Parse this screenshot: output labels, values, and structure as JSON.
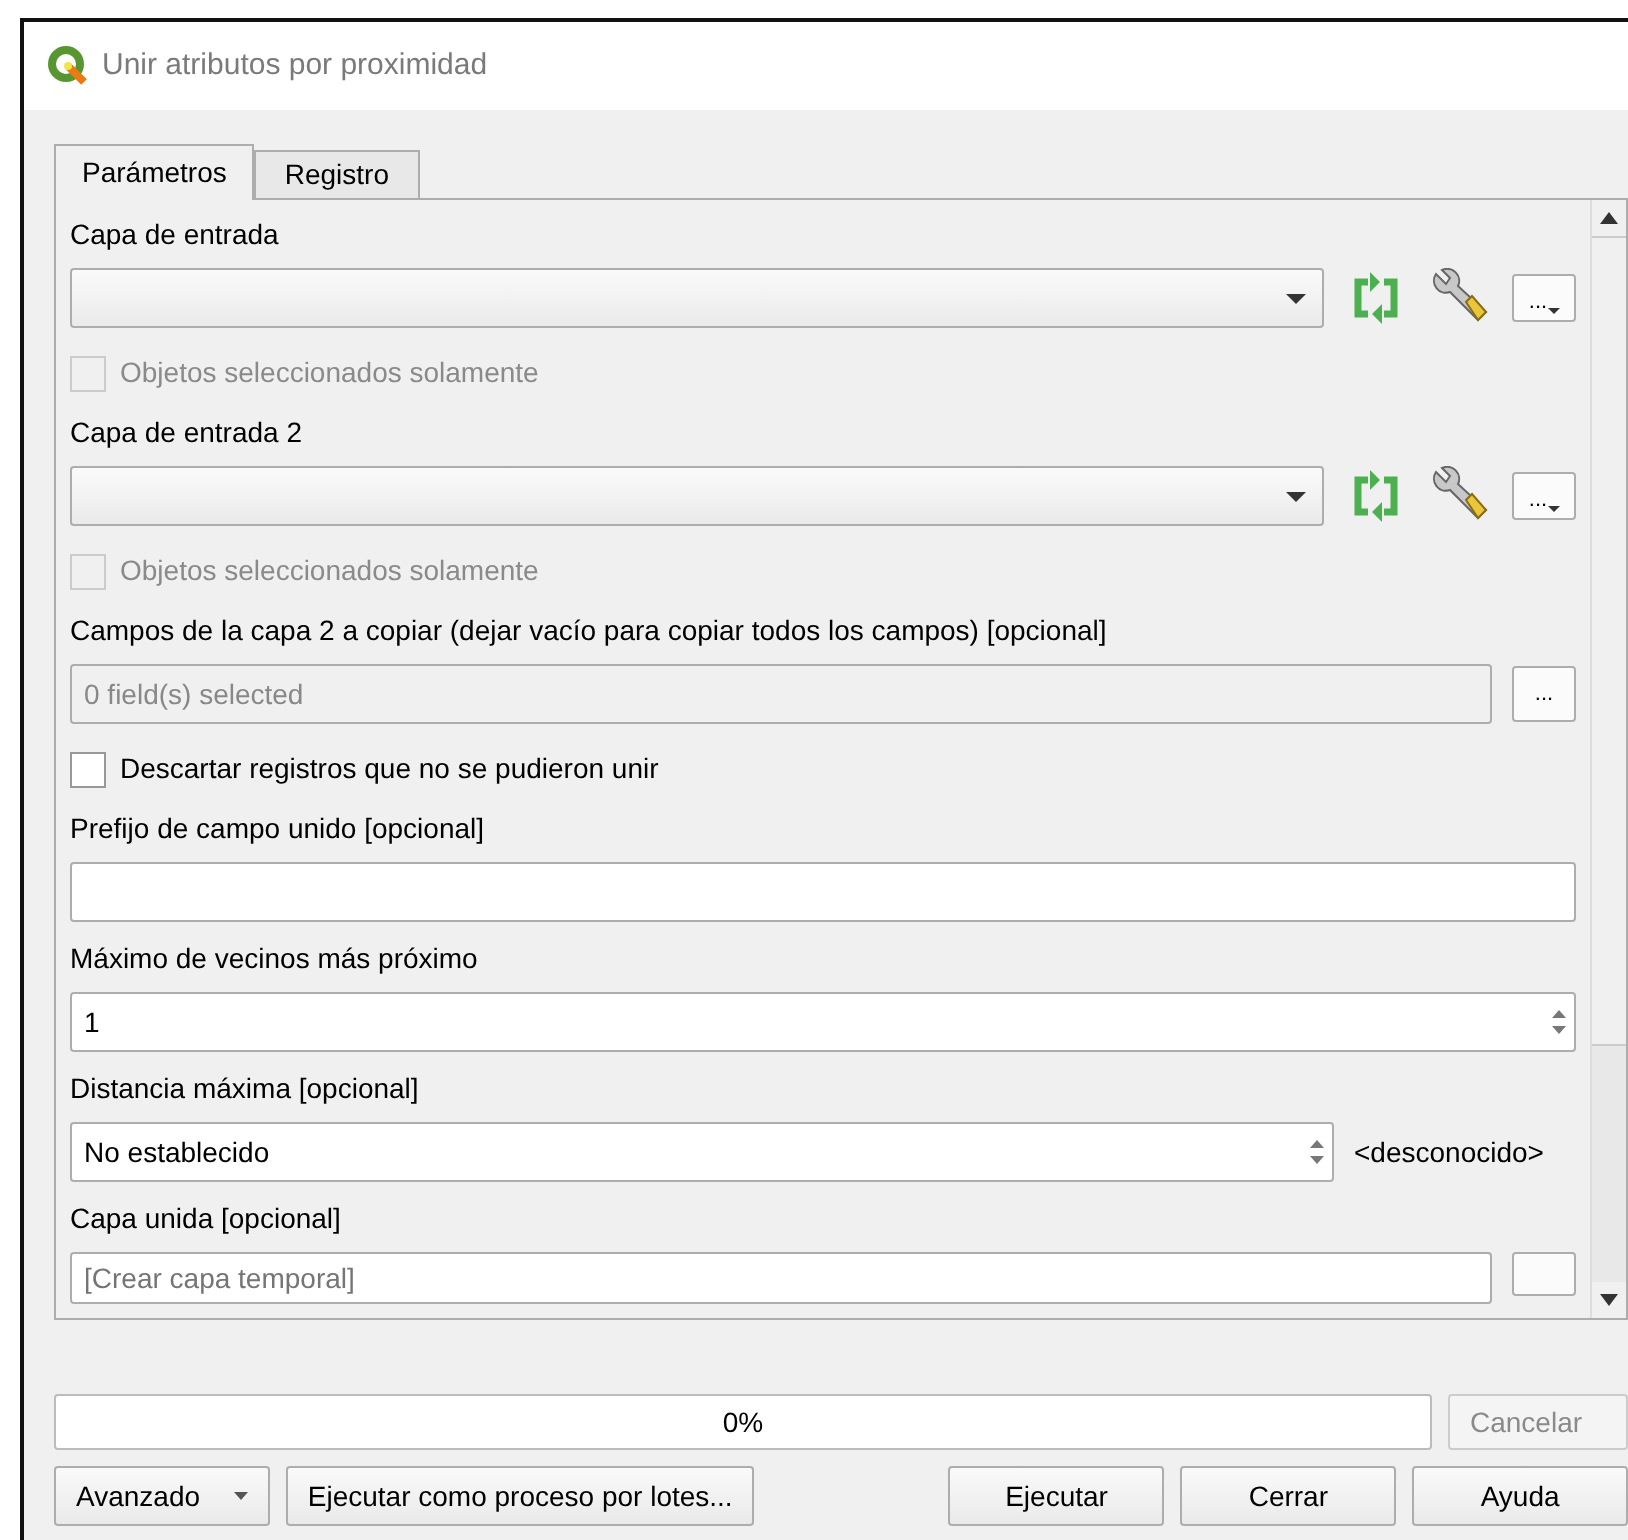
{
  "window": {
    "title": "Unir atributos por proximidad"
  },
  "tabs": [
    {
      "label": "Parámetros",
      "selected": true
    },
    {
      "label": "Registro",
      "selected": false
    }
  ],
  "params": [
    {
      "kind": "label",
      "text": "Capa de entrada"
    },
    {
      "kind": "layer_combo",
      "menu_button": "..."
    },
    {
      "kind": "checkbox",
      "label": "Objetos seleccionados solamente",
      "checked": false,
      "disabled": true
    },
    {
      "kind": "label",
      "text": "Capa de entrada 2"
    },
    {
      "kind": "layer_combo",
      "menu_button": "..."
    },
    {
      "kind": "checkbox",
      "label": "Objetos seleccionados solamente",
      "checked": false,
      "disabled": true
    },
    {
      "kind": "label",
      "text": "Campos de la capa 2 a copiar (dejar vacío para copiar todos los campos) [opcional]"
    },
    {
      "kind": "multi",
      "value": "0 field(s) selected",
      "button": "..."
    },
    {
      "kind": "checkbox",
      "label": "Descartar registros que no se pudieron unir",
      "checked": false,
      "disabled": false
    },
    {
      "kind": "label",
      "text": "Prefijo de campo unido [opcional]"
    },
    {
      "kind": "text"
    },
    {
      "kind": "label",
      "text": "Máximo de vecinos más próximo"
    },
    {
      "kind": "spin",
      "value": "1"
    },
    {
      "kind": "label",
      "text": "Distancia máxima [opcional]"
    },
    {
      "kind": "double_spin",
      "value": "No establecido",
      "unit": "<desconocido>"
    },
    {
      "kind": "label",
      "text": "Capa unida [opcional]"
    },
    {
      "kind": "sink",
      "placeholder": "[Crear capa temporal]"
    }
  ],
  "progress": {
    "level": 0,
    "text": "0%"
  },
  "cancel": {
    "label": "Cancelar",
    "disabled": true
  },
  "buttons": [
    {
      "label": "Avanzado",
      "kind": "dropdown"
    },
    {
      "label": "Ejecutar como proceso por lotes...",
      "kind": "plain"
    },
    {
      "label": "Ejecutar",
      "kind": "plain"
    },
    {
      "label": "Cerrar",
      "kind": "plain"
    },
    {
      "label": "Ayuda",
      "kind": "plain"
    }
  ]
}
